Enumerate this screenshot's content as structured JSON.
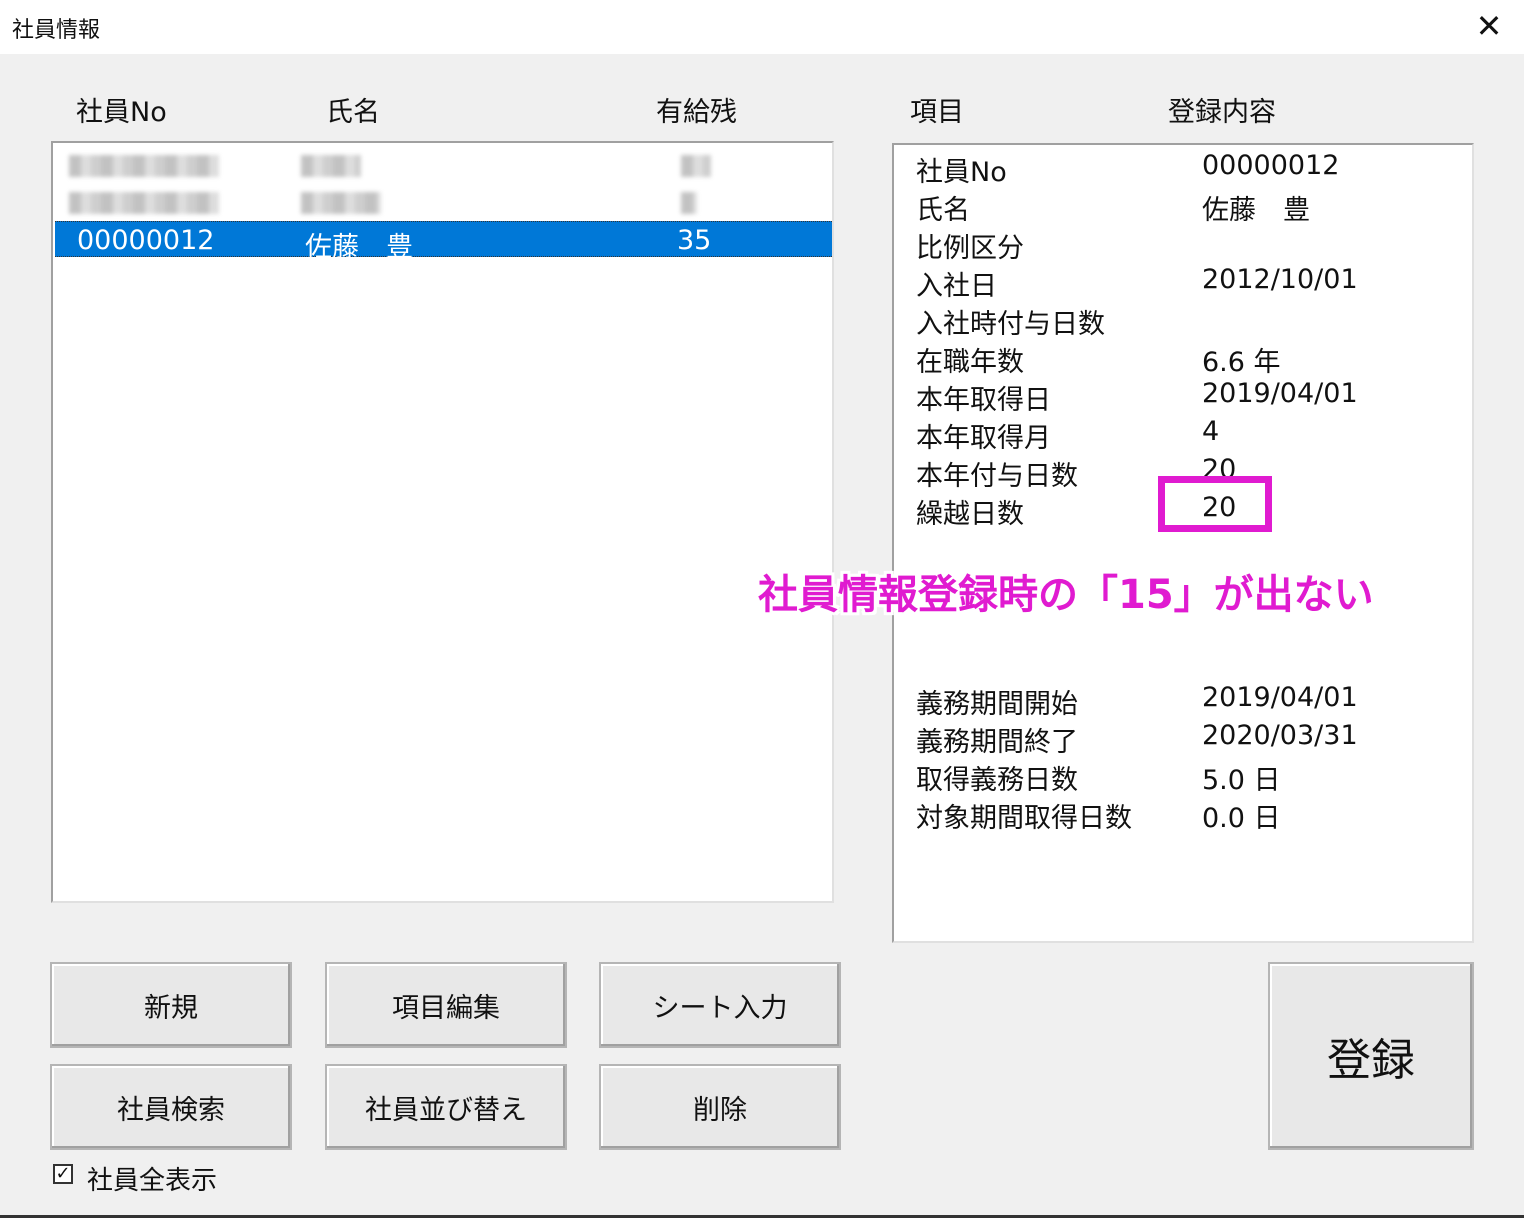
{
  "window": {
    "title": "社員情報",
    "close_glyph": "✕"
  },
  "list": {
    "headers": {
      "no": "社員No",
      "name": "氏名",
      "remaining": "有給残"
    },
    "rows": [
      {
        "no": "",
        "name": "",
        "remaining": "",
        "blurred": true
      },
      {
        "no": "",
        "name": "",
        "remaining": "",
        "blurred": true
      },
      {
        "no": "00000012",
        "name": "佐藤　豊",
        "remaining": "35",
        "selected": true
      }
    ]
  },
  "detail": {
    "headers": {
      "item": "項目",
      "content": "登録内容"
    },
    "rows": [
      {
        "label": "社員No",
        "value": "00000012"
      },
      {
        "label": "氏名",
        "value": "佐藤　豊"
      },
      {
        "label": "比例区分",
        "value": ""
      },
      {
        "label": "入社日",
        "value": "2012/10/01"
      },
      {
        "label": "入社時付与日数",
        "value": ""
      },
      {
        "label": "在職年数",
        "value": "6.6 年"
      },
      {
        "label": "本年取得日",
        "value": "2019/04/01"
      },
      {
        "label": "本年取得月",
        "value": "4"
      },
      {
        "label": "本年付与日数",
        "value": "20"
      },
      {
        "label": "繰越日数",
        "value": "20"
      },
      {
        "label": "義務期間開始",
        "value": "2019/04/01"
      },
      {
        "label": "義務期間終了",
        "value": "2020/03/31"
      },
      {
        "label": "取得義務日数",
        "value": "5.0 日"
      },
      {
        "label": "対象期間取得日数",
        "value": "0.0 日"
      }
    ]
  },
  "annotation": {
    "text": "社員情報登録時の「15」が出ない",
    "color": "#e01bd0"
  },
  "buttons": {
    "new": "新規",
    "edit_items": "項目編集",
    "sheet_input": "シート入力",
    "search": "社員検索",
    "sort": "社員並び替え",
    "delete": "削除",
    "register": "登録"
  },
  "show_all": {
    "label": "社員全表示",
    "checked": true,
    "check_glyph": "☑"
  },
  "colors": {
    "selection": "#0078d7",
    "highlight": "#e01bd0"
  }
}
